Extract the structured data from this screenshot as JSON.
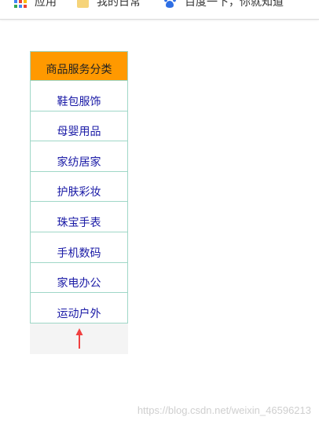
{
  "bookmarks": [
    {
      "label": "应用",
      "icon": "apps-icon"
    },
    {
      "label": "我的日常",
      "icon": "folder-icon"
    },
    {
      "label": "百度一下，你就知道",
      "icon": "baidu-icon"
    }
  ],
  "category": {
    "header": "商品服务分类",
    "items": [
      "鞋包服饰",
      "母婴用品",
      "家纺居家",
      "护肤彩妆",
      "珠宝手表",
      "手机数码",
      "家电办公",
      "运动户外"
    ],
    "header_color": "#ff9900",
    "border_color": "#9fd7c7",
    "link_color": "#1a1aa6",
    "arrow_color": "#f04040"
  },
  "watermark": "https://blog.csdn.net/weixin_46596213"
}
